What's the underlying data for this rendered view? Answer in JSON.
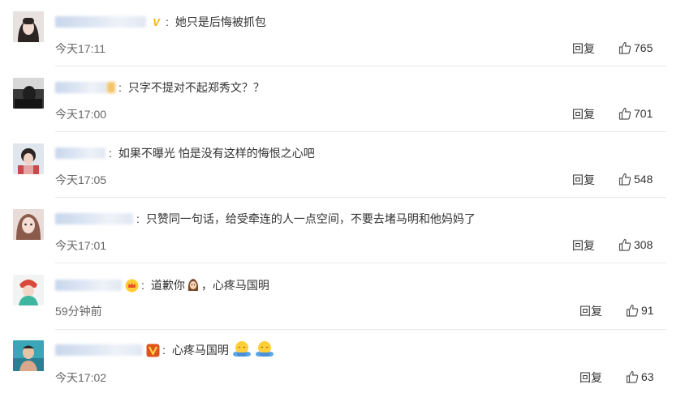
{
  "comments": [
    {
      "text": "她只是后悔被抓包",
      "time": "今天17:11",
      "reply": "回复",
      "likes": "765",
      "badge": "V",
      "badge_color": "#f3b400"
    },
    {
      "text": "只字不提对不起郑秀文？？",
      "time": "今天17:00",
      "reply": "回复",
      "likes": "701",
      "badge": "",
      "badge_color": "#f3a33c"
    },
    {
      "text": "如果不曝光 怕是没有这样的悔恨之心吧",
      "time": "今天17:05",
      "reply": "回复",
      "likes": "548",
      "badge": "",
      "badge_color": ""
    },
    {
      "text": "只赞同一句话，给受牵连的人一点空间，不要去堵马明和他妈妈了",
      "time": "今天17:01",
      "reply": "回复",
      "likes": "308",
      "badge": "",
      "badge_color": ""
    },
    {
      "text_a": "道歉你",
      "text_b": "，心疼马国明",
      "time": "59分钟前",
      "reply": "回复",
      "likes": "91",
      "badge": "crown",
      "badge_color": "#e64b2c"
    },
    {
      "text": "心疼马国明",
      "time": "今天17:02",
      "reply": "回复",
      "likes": "63",
      "badge": "V",
      "badge_color": "#e0521c"
    }
  ],
  "icons": {
    "like": "thumbs-up-icon",
    "vip": "vip-badge-icon",
    "emoji": "face-emoji-icon",
    "hug": "hug-emoji-icon"
  },
  "colors": {
    "text": "#333333",
    "time": "#666666",
    "separator": "#e8e8e8",
    "vip_gold": "#f3b400",
    "vip_red": "#e0521c"
  }
}
